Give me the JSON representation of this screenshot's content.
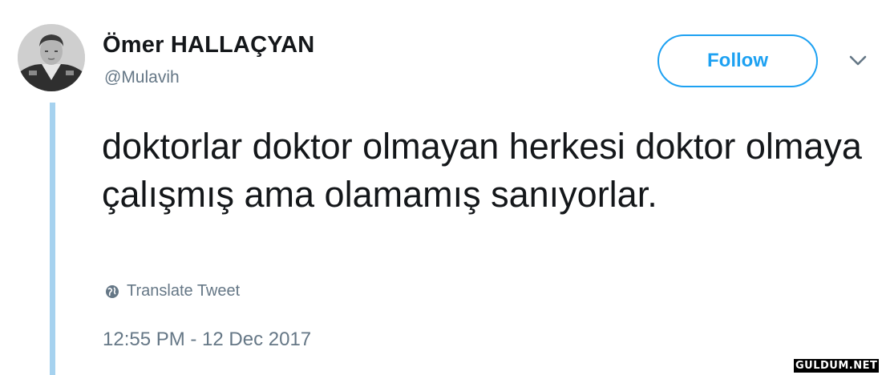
{
  "tweet": {
    "author": {
      "display_name": "Ömer HALLAÇYAN",
      "handle": "@Mulavih",
      "avatar_icon": "portrait-engraving"
    },
    "follow_label": "Follow",
    "text": "doktorlar doktor olmayan herkesi doktor olmaya çalışmış ama olamamış sanıyorlar.",
    "translate_label": "Translate Tweet",
    "timestamp": "12:55 PM - 12 Dec 2017"
  },
  "watermark": "GULDUM.NET",
  "colors": {
    "accent": "#1da1f2",
    "thread_line": "#a6d2ef",
    "muted_text": "#657786",
    "primary_text": "#14171a"
  }
}
